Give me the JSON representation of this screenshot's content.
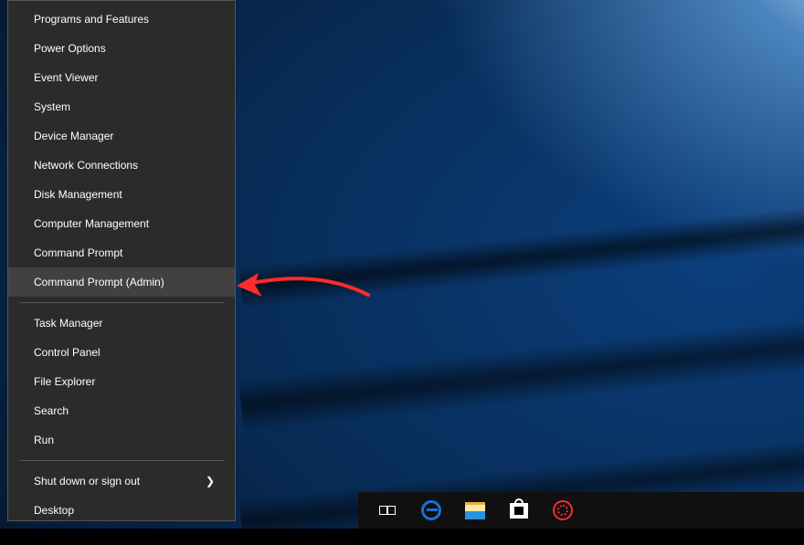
{
  "winx_menu": {
    "group1": [
      {
        "label": "Programs and Features"
      },
      {
        "label": "Power Options"
      },
      {
        "label": "Event Viewer"
      },
      {
        "label": "System"
      },
      {
        "label": "Device Manager"
      },
      {
        "label": "Network Connections"
      },
      {
        "label": "Disk Management"
      },
      {
        "label": "Computer Management"
      },
      {
        "label": "Command Prompt"
      },
      {
        "label": "Command Prompt (Admin)",
        "highlighted": true
      }
    ],
    "group2": [
      {
        "label": "Task Manager"
      },
      {
        "label": "Control Panel"
      },
      {
        "label": "File Explorer"
      },
      {
        "label": "Search"
      },
      {
        "label": "Run"
      }
    ],
    "group3": [
      {
        "label": "Shut down or sign out",
        "has_submenu": true
      },
      {
        "label": "Desktop"
      }
    ]
  },
  "taskbar": {
    "items": [
      {
        "name": "task-view",
        "icon": "taskview-icon"
      },
      {
        "name": "edge-browser",
        "icon": "edge-icon"
      },
      {
        "name": "file-explorer",
        "icon": "file-explorer-icon"
      },
      {
        "name": "store",
        "icon": "store-icon"
      },
      {
        "name": "red-launcher",
        "icon": "gear-red-icon"
      }
    ]
  },
  "annotation": {
    "arrow_color": "#ff2a2a",
    "points_to": "Command Prompt (Admin)"
  },
  "colors": {
    "menu_bg": "#2b2b2b",
    "menu_hover": "#414141",
    "menu_border": "#555555",
    "taskbar_bg": "#101010"
  }
}
